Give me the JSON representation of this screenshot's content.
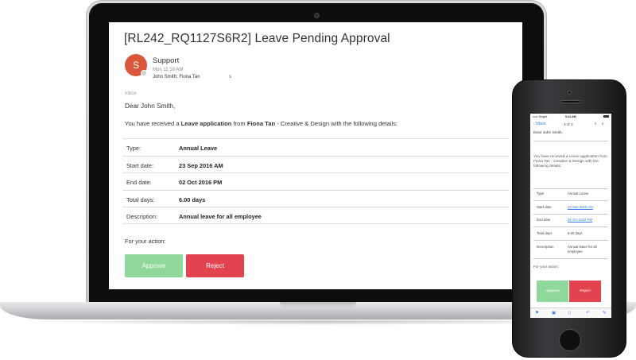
{
  "email": {
    "subject": "[RL242_RQ1127S6R2] Leave Pending Approval",
    "avatar_initial": "S",
    "sender": "Support",
    "time": "Mon 11:18 AM",
    "recipients": "John Smith; Fiona Tan",
    "recipients_tail": "s",
    "folder": "Inbox",
    "greeting": "Dear John Smith,",
    "intro": {
      "prefix": "You have received a ",
      "type": "Leave application",
      "from": " from ",
      "applicant": "Fiona Tan",
      "suffix": "  - Creative & Design with the following details:"
    },
    "details": [
      {
        "label": "Type:",
        "value": "Annual Leave"
      },
      {
        "label": "Start date:",
        "value": "23 Sep 2016 AM"
      },
      {
        "label": "End date:",
        "value": "02 Oct 2016 PM"
      },
      {
        "label": "Total days:",
        "value": "6.00 days"
      },
      {
        "label": "Description:",
        "value": "Annual leave for all employee"
      }
    ],
    "action_label": "For your action:",
    "approve_label": "Approve",
    "reject_label": "Reject"
  },
  "phone": {
    "carrier": "••••• Singtel",
    "time": "9:41 AM",
    "back_label": "‹ Inbox",
    "count": "3 of 3",
    "nav_arrows": "∧ ∨",
    "greeting": "Dear John Smith,",
    "body": "You have received a Leave application from Fiona Tan - Creative & Design with the following details:",
    "details": [
      {
        "label": "Type",
        "value": "Annual Leave"
      },
      {
        "label": "Start date",
        "value": "23 Sep 2016 AM"
      },
      {
        "label": "End date",
        "value": "02 Oct 2016 PM"
      },
      {
        "label": "Total days",
        "value": "6.00 days"
      },
      {
        "label": "Description",
        "value": "Annual leave for all employee"
      }
    ],
    "action_label": "For your action:",
    "approve_label": "Approve",
    "reject_label": "Reject",
    "toolbar_icons": [
      "flag-icon",
      "folder-icon",
      "trash-icon",
      "reply-icon",
      "compose-icon"
    ]
  },
  "colors": {
    "approve": "#90d79c",
    "reject": "#e2434f",
    "avatar": "#d9583b",
    "ios_blue": "#3478f6"
  }
}
